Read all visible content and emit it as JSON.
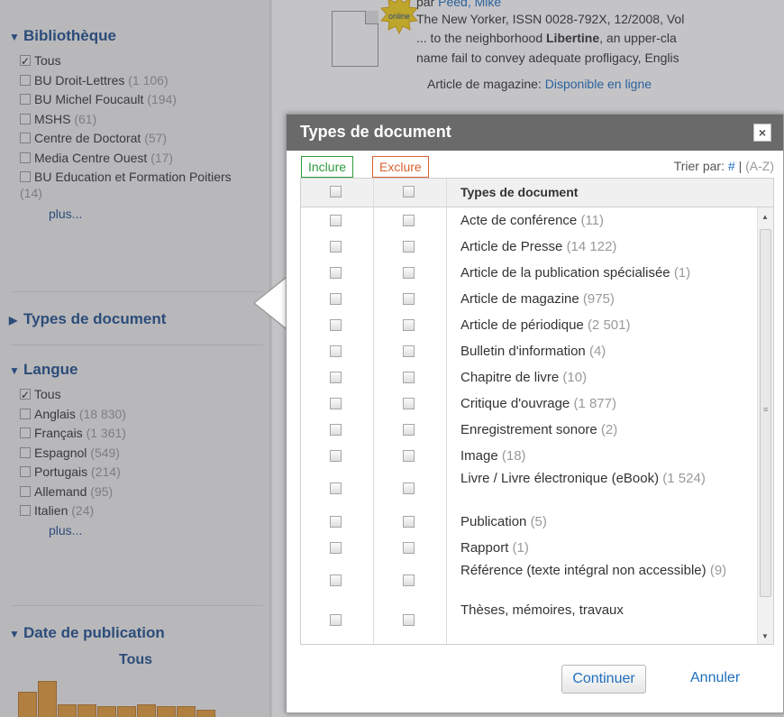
{
  "sidebar": {
    "bibliotheque": {
      "title": "Bibliothèque",
      "items": [
        {
          "label": "Tous",
          "count": "",
          "checked": true
        },
        {
          "label": "BU Droit-Lettres",
          "count": "(1 106)",
          "checked": false
        },
        {
          "label": "BU Michel Foucault",
          "count": "(194)",
          "checked": false
        },
        {
          "label": "MSHS",
          "count": "(61)",
          "checked": false
        },
        {
          "label": "Centre de Doctorat",
          "count": "(57)",
          "checked": false
        },
        {
          "label": "Media Centre Ouest",
          "count": "(17)",
          "checked": false
        },
        {
          "label": "BU Education et Formation Poitiers",
          "count": "(14)",
          "checked": false
        }
      ],
      "more": "plus..."
    },
    "types": {
      "title": "Types de document"
    },
    "langue": {
      "title": "Langue",
      "items": [
        {
          "label": "Tous",
          "count": "",
          "checked": true
        },
        {
          "label": "Anglais",
          "count": "(18 830)",
          "checked": false
        },
        {
          "label": "Français",
          "count": "(1 361)",
          "checked": false
        },
        {
          "label": "Espagnol",
          "count": "(549)",
          "checked": false
        },
        {
          "label": "Portugais",
          "count": "(214)",
          "checked": false
        },
        {
          "label": "Allemand",
          "count": "(95)",
          "checked": false
        },
        {
          "label": "Italien",
          "count": "(24)",
          "checked": false
        }
      ],
      "more": "plus..."
    },
    "date": {
      "title": "Date de publication",
      "value": "Tous"
    }
  },
  "result": {
    "badge": "online",
    "line1_prefix": "par ",
    "line1_author": "Peed, Mike",
    "line2": "The New Yorker, ISSN 0028-792X, 12/2008, Vol",
    "line3_prefix": "... to the neighborhood ",
    "line3_bold": "Libertine",
    "line3_suffix": ", an upper-cla",
    "line4": "name fail to convey adequate profligacy, Englis",
    "line5_prefix": "Article de magazine: ",
    "line5_link": "Disponible en ligne"
  },
  "modal": {
    "title": "Types de document",
    "close": "×",
    "tab_include": "Inclure",
    "tab_exclude": "Exclure",
    "sort_label": "Trier par:",
    "sort_hash": "#",
    "sort_sep": "|",
    "sort_az": "(A-Z)",
    "column_header": "Types de document",
    "rows": [
      {
        "label": "Acte de conférence",
        "count": "(11)"
      },
      {
        "label": "Article de Presse",
        "count": "(14 122)"
      },
      {
        "label": "Article de la publication spécialisée",
        "count": "(1)"
      },
      {
        "label": "Article de magazine",
        "count": "(975)"
      },
      {
        "label": "Article de périodique",
        "count": "(2 501)"
      },
      {
        "label": "Bulletin d'information",
        "count": "(4)"
      },
      {
        "label": "Chapitre de livre",
        "count": "(10)"
      },
      {
        "label": "Critique d'ouvrage",
        "count": "(1 877)"
      },
      {
        "label": "Enregistrement sonore",
        "count": "(2)"
      },
      {
        "label": "Image",
        "count": "(18)"
      },
      {
        "label": "Livre / Livre électronique (eBook)",
        "count": "(1 524)"
      },
      {
        "label": "Publication",
        "count": "(5)"
      },
      {
        "label": "Rapport",
        "count": "(1)"
      },
      {
        "label": "Référence (texte intégral non accessible)",
        "count": "(9)"
      },
      {
        "label": "Thèses, mémoires, travaux",
        "count": ""
      }
    ],
    "btn_continue": "Continuer",
    "btn_cancel": "Annuler"
  },
  "colors": {
    "link": "#1f6fbd",
    "heading": "#1f4e8c",
    "include": "#2e9b3b",
    "exclude": "#d9602f",
    "histogram": "#e39b3a",
    "titlebar": "#6a6a6a"
  },
  "icons": [
    "facet-expanded-icon",
    "facet-collapsed-icon",
    "checkbox-icon",
    "close-icon",
    "document-icon",
    "scroll-up-icon",
    "scroll-down-icon"
  ],
  "histogram": {
    "relative_heights": [
      0.7,
      1.0,
      0.35,
      0.35,
      0.3,
      0.3,
      0.35,
      0.3,
      0.3,
      0.2
    ]
  }
}
